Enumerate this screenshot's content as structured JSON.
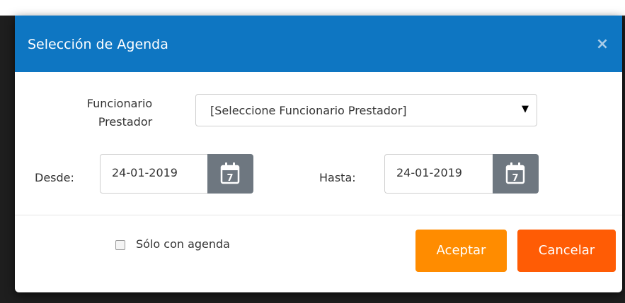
{
  "dialog": {
    "title": "Selección de Agenda",
    "close_symbol": "×"
  },
  "form": {
    "funcionario_label_line1": "Funcionario",
    "funcionario_label_line2": "Prestador",
    "funcionario_selected": "[Seleccione Funcionario Prestador]",
    "desde_label": "Desde:",
    "desde_value": "24-01-2019",
    "hasta_label": "Hasta:",
    "hasta_value": "24-01-2019",
    "calendar_icon": "calendar-icon",
    "calendar_day": "7"
  },
  "options": {
    "solo_con_agenda_label": "Sólo con agenda",
    "solo_con_agenda_checked": false
  },
  "buttons": {
    "accept": "Aceptar",
    "cancel": "Cancelar"
  },
  "colors": {
    "header": "#0e76c2",
    "accept": "#ff8c00",
    "cancel": "#ff5c05",
    "calendar_button": "#6e7780"
  }
}
